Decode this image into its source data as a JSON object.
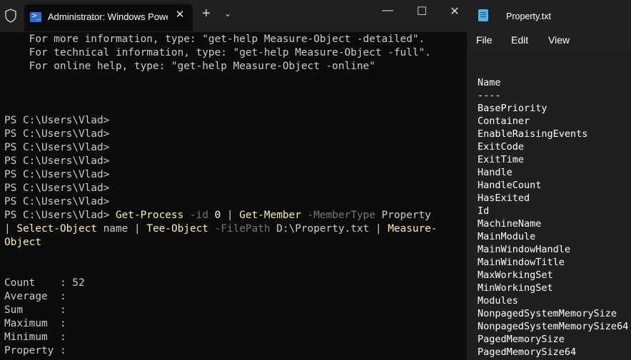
{
  "terminal": {
    "tab_title": "Administrator: Windows PowerShell",
    "tab_close": "✕",
    "new_tab": "+",
    "dropdown": "⌄",
    "minimize": "—",
    "maximize": "☐",
    "close": "✕",
    "help_lines": [
      "    For more information, type: \"get-help Measure-Object -detailed\".",
      "    For technical information, type: \"get-help Measure-Object -full\".",
      "    For online help, type: \"get-help Measure-Object -online\""
    ],
    "prompts": [
      "PS C:\\Users\\Vlad>",
      "PS C:\\Users\\Vlad>",
      "PS C:\\Users\\Vlad>",
      "PS C:\\Users\\Vlad>",
      "PS C:\\Users\\Vlad>",
      "PS C:\\Users\\Vlad>",
      "PS C:\\Users\\Vlad>"
    ],
    "command": {
      "prompt": "PS C:\\Users\\Vlad> ",
      "cmd1": "Get-Process",
      "p1": " -id",
      "a1": " 0",
      "pipe1": " | ",
      "cmd2": "Get-Member",
      "p2": " -MemberType",
      "a2": " Property",
      "pipe2": "| ",
      "cmd3": "Select-Object",
      "a3": " name",
      "pipe3": " | ",
      "cmd4": "Tee-Object",
      "p4": " -FilePath",
      "a4": " D:\\Property.txt",
      "pipe4": " | ",
      "cmd5a": "Measure-",
      "cmd5b": "Object"
    },
    "results": [
      {
        "label": "Count    :",
        "value": " 52"
      },
      {
        "label": "Average  :",
        "value": ""
      },
      {
        "label": "Sum      :",
        "value": ""
      },
      {
        "label": "Maximum  :",
        "value": ""
      },
      {
        "label": "Minimum  :",
        "value": ""
      },
      {
        "label": "Property :",
        "value": ""
      }
    ]
  },
  "notepad": {
    "title": "Property.txt",
    "menu": [
      "File",
      "Edit",
      "View"
    ],
    "lines": [
      "Name",
      "----",
      "BasePriority",
      "Container",
      "EnableRaisingEvents",
      "ExitCode",
      "ExitTime",
      "Handle",
      "HandleCount",
      "HasExited",
      "Id",
      "MachineName",
      "MainModule",
      "MainWindowHandle",
      "MainWindowTitle",
      "MaxWorkingSet",
      "MinWorkingSet",
      "Modules",
      "NonpagedSystemMemorySize",
      "NonpagedSystemMemorySize64",
      "PagedMemorySize",
      "PagedMemorySize64"
    ]
  }
}
